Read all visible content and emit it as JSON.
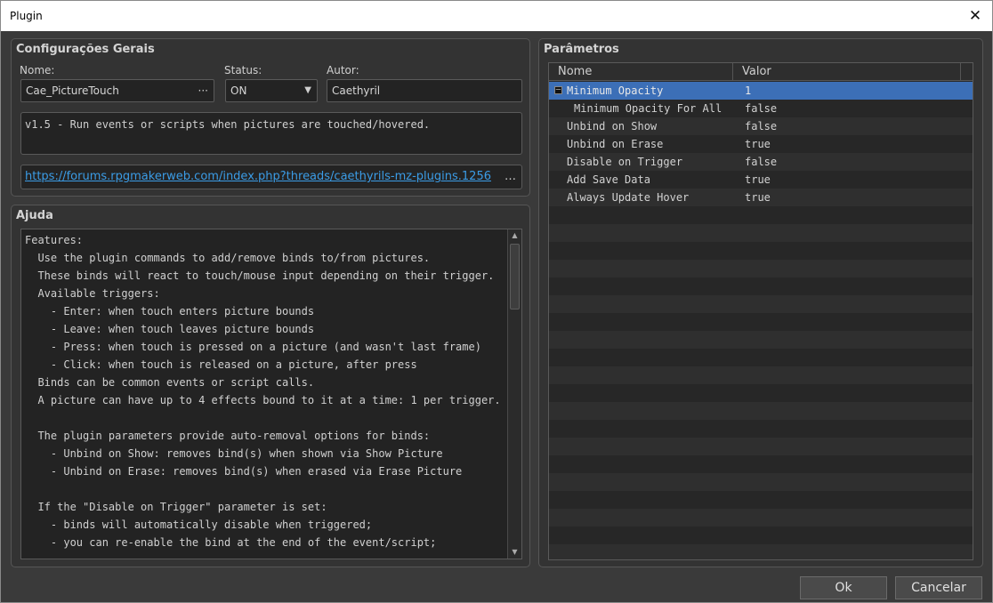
{
  "window": {
    "title": "Plugin",
    "close_symbol": "✕"
  },
  "general": {
    "title": "Configurações Gerais",
    "name_label": "Nome:",
    "name_value": "Cae_PictureTouch",
    "name_button": "···",
    "status_label": "Status:",
    "status_value": "ON",
    "author_label": "Autor:",
    "author_value": "Caethyril",
    "description": "v1.5 - Run events or scripts when pictures are touched/hovered.",
    "url": "https://forums.rpgmakerweb.com/index.php?threads/caethyrils-mz-plugins.1256",
    "url_ellipsis": "…"
  },
  "help": {
    "title": "Ajuda",
    "text": "Features:\n  Use the plugin commands to add/remove binds to/from pictures.\n  These binds will react to touch/mouse input depending on their trigger.\n  Available triggers:\n    - Enter: when touch enters picture bounds\n    - Leave: when touch leaves picture bounds\n    - Press: when touch is pressed on a picture (and wasn't last frame)\n    - Click: when touch is released on a picture, after press\n  Binds can be common events or script calls.\n  A picture can have up to 4 effects bound to it at a time: 1 per trigger.\n\n  The plugin parameters provide auto-removal options for binds:\n    - Unbind on Show: removes bind(s) when shown via Show Picture\n    - Unbind on Erase: removes bind(s) when erased via Erase Picture\n\n  If the \"Disable on Trigger\" parameter is set:\n    - binds will automatically disable when triggered;\n    - you can re-enable the bind at the end of the event/script;"
  },
  "params": {
    "title": "Parâmetros",
    "col_name": "Nome",
    "col_value": "Valor",
    "rows": [
      {
        "name": "Minimum Opacity",
        "value": "1"
      },
      {
        "name": "Minimum Opacity For All",
        "value": "false"
      },
      {
        "name": "Unbind on Show",
        "value": "false"
      },
      {
        "name": "Unbind on Erase",
        "value": "true"
      },
      {
        "name": "Disable on Trigger",
        "value": "false"
      },
      {
        "name": "Add Save Data",
        "value": "true"
      },
      {
        "name": "Always Update Hover",
        "value": "true"
      }
    ]
  },
  "buttons": {
    "ok": "Ok",
    "cancel": "Cancelar"
  }
}
